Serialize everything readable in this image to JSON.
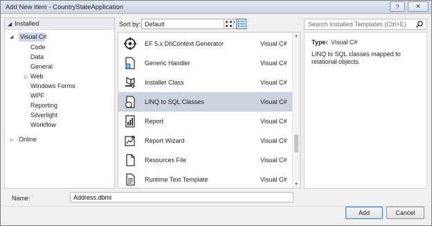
{
  "window": {
    "title": "Add New Item - CountryStateApplication",
    "help_label": "?",
    "close_label": "✕"
  },
  "tree": {
    "installed": "Installed",
    "items": [
      {
        "label": "Visual C#",
        "selected": true,
        "arrow": "◢"
      },
      {
        "label": "Code"
      },
      {
        "label": "Data"
      },
      {
        "label": "General"
      },
      {
        "label": "Web",
        "arrow": "▷"
      },
      {
        "label": "Windows Forms"
      },
      {
        "label": "WPF"
      },
      {
        "label": "Reporting"
      },
      {
        "label": "Silverlight"
      },
      {
        "label": "Workflow"
      }
    ],
    "online": "Online"
  },
  "sort": {
    "label": "Sort by:",
    "value": "Default"
  },
  "templates": [
    {
      "name": "EF 5.x DbContext Generator",
      "lang": "Visual C#",
      "icon": "ef-generator-icon"
    },
    {
      "name": "Generic Handler",
      "lang": "Visual C#",
      "icon": "generic-handler-icon"
    },
    {
      "name": "Installer Class",
      "lang": "Visual C#",
      "icon": "installer-class-icon"
    },
    {
      "name": "LINQ to SQL Classes",
      "lang": "Visual C#",
      "icon": "linq-to-sql-icon",
      "selected": true
    },
    {
      "name": "Report",
      "lang": "Visual C#",
      "icon": "report-icon"
    },
    {
      "name": "Report Wizard",
      "lang": "Visual C#",
      "icon": "report-wizard-icon"
    },
    {
      "name": "Resources File",
      "lang": "Visual C#",
      "icon": "resources-file-icon"
    },
    {
      "name": "Runtime Text Template",
      "lang": "Visual C#",
      "icon": "text-template-icon"
    }
  ],
  "search": {
    "placeholder": "Search Installed Templates (Ctrl+E)"
  },
  "details": {
    "type_label": "Type:",
    "type_value": "Visual C#",
    "description": "LINQ to SQL classes mapped to relational objects."
  },
  "name_field": {
    "label": "Name:",
    "value": "Address.dbml"
  },
  "buttons": {
    "add": "Add",
    "cancel": "Cancel"
  }
}
